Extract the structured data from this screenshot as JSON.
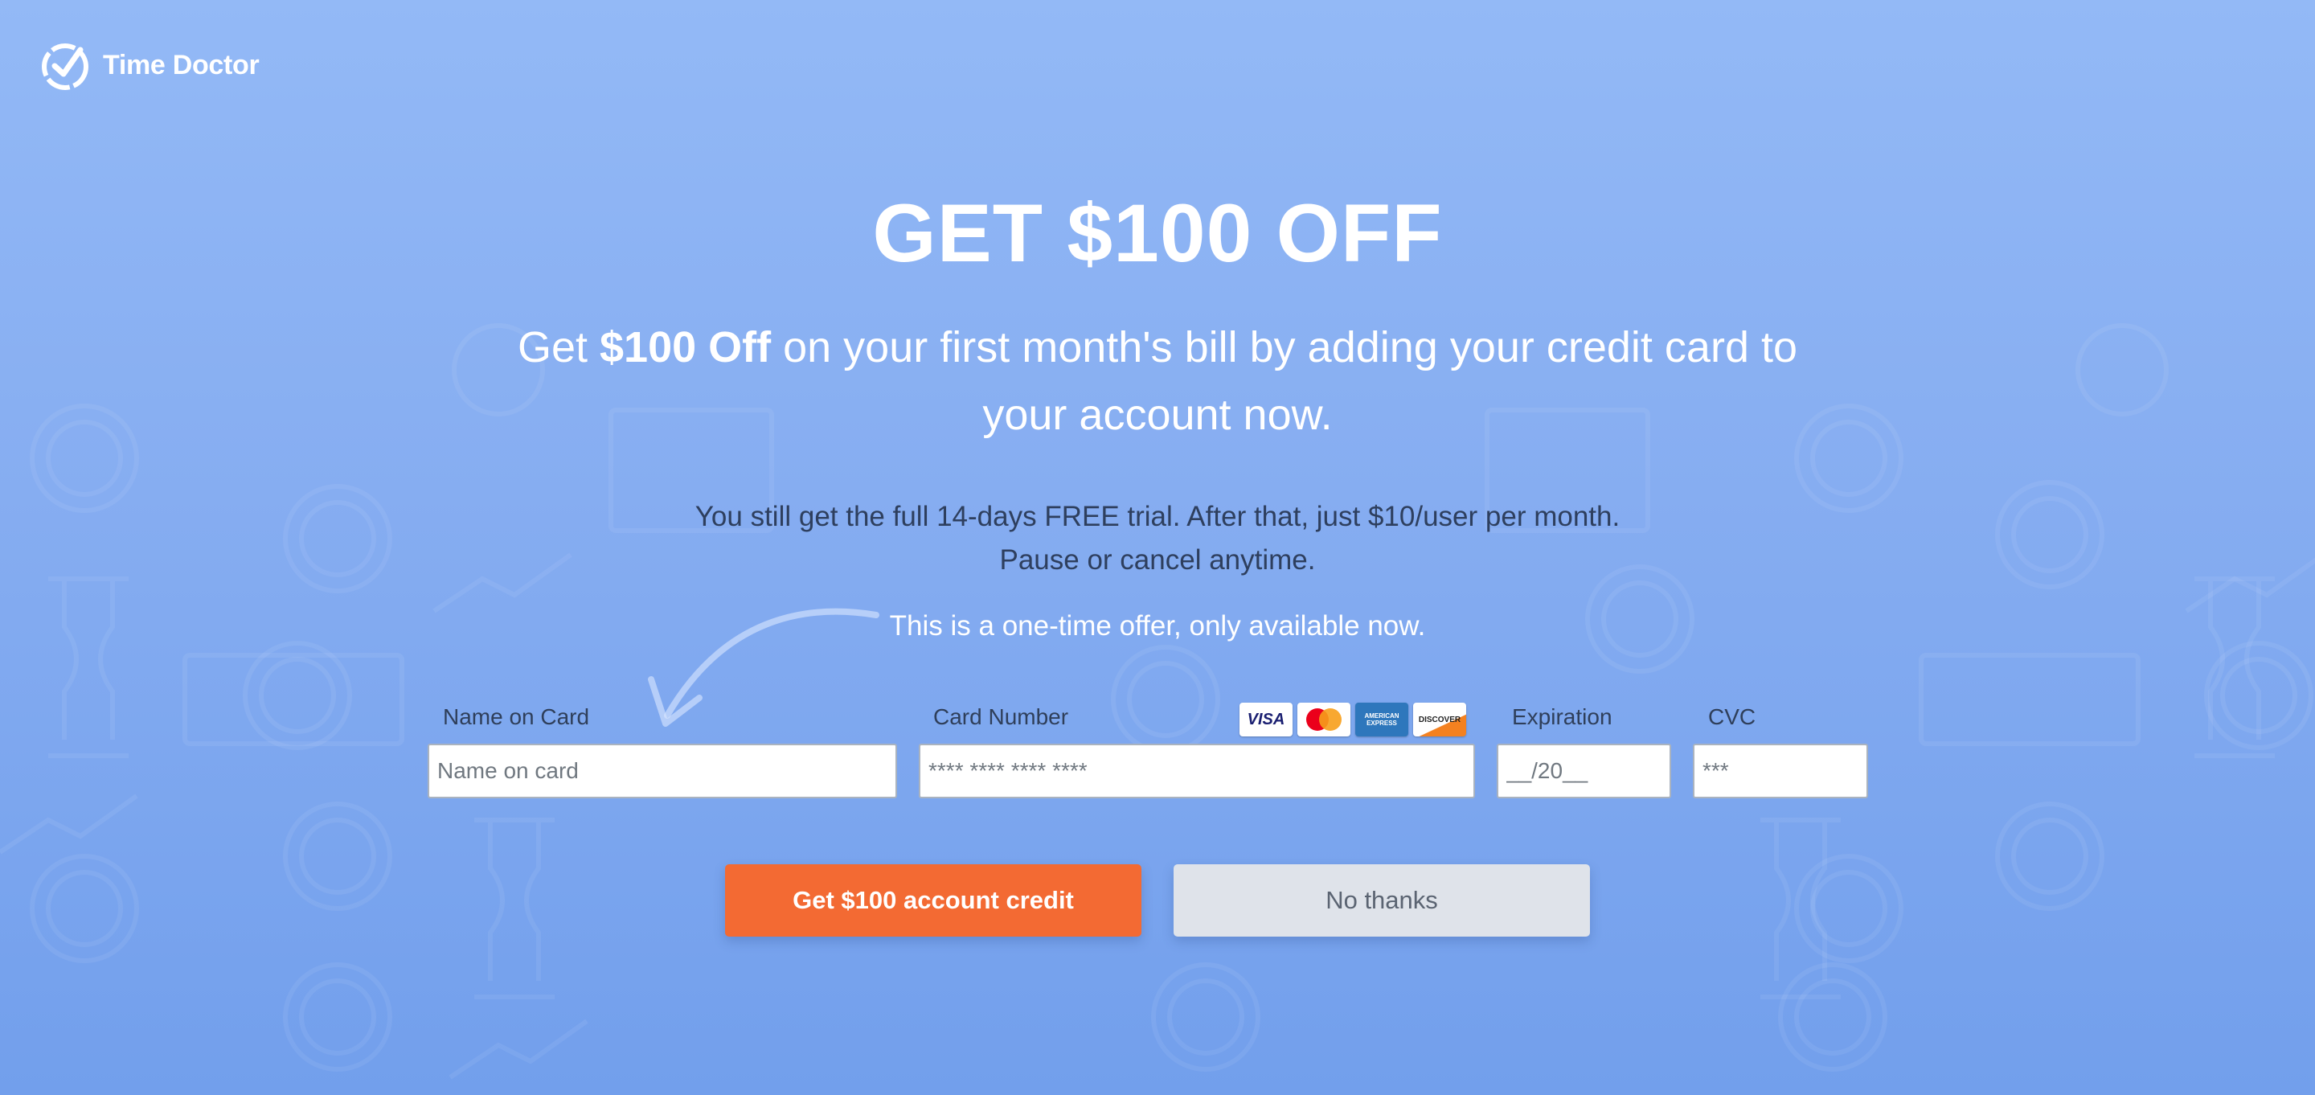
{
  "brand": {
    "name": "Time Doctor"
  },
  "headline": "GET $100 OFF",
  "subhead": {
    "prefix": "Get ",
    "highlight": "$100 Off",
    "suffix": " on your first month's bill by adding your credit card to your account now."
  },
  "trial": {
    "line1": "You still get the full 14-days FREE trial. After that, just $10/user per month.",
    "line2": "Pause or cancel anytime."
  },
  "offer_note": "This is a one-time offer, only available now.",
  "form": {
    "name": {
      "label": "Name on Card",
      "placeholder": "Name on card"
    },
    "card_number": {
      "label": "Card Number",
      "placeholder": "**** **** **** ****"
    },
    "expiration": {
      "label": "Expiration",
      "placeholder": "__/20__"
    },
    "cvc": {
      "label": "CVC",
      "placeholder": "***"
    },
    "card_brands": [
      "VISA",
      "MasterCard",
      "AMERICAN EXPRESS",
      "DISCOVER"
    ]
  },
  "buttons": {
    "primary": "Get $100 account credit",
    "secondary": "No thanks"
  },
  "colors": {
    "background": "#8cb3f4",
    "accent": "#f36a33",
    "secondary_button": "#dfe3ea"
  }
}
